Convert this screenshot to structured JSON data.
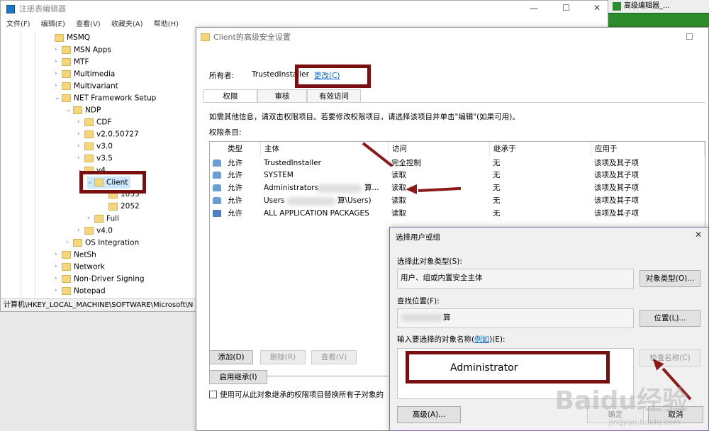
{
  "registry": {
    "title": "注册表编辑器",
    "menu": [
      "文件(F)",
      "编辑(E)",
      "查看(V)",
      "收藏夹(A)",
      "帮助(H)"
    ],
    "tree": [
      {
        "label": "MSMQ"
      },
      {
        "label": "MSN Apps"
      },
      {
        "label": "MTF"
      },
      {
        "label": "Multimedia"
      },
      {
        "label": "Multivariant"
      },
      {
        "label": "NET Framework Setup"
      },
      {
        "label": "NDP"
      },
      {
        "label": "CDF"
      },
      {
        "label": "v2.0.50727"
      },
      {
        "label": "v3.0"
      },
      {
        "label": "v3.5"
      },
      {
        "label": "v4"
      },
      {
        "label": "Client"
      },
      {
        "label": "1033"
      },
      {
        "label": "2052"
      },
      {
        "label": "Full"
      },
      {
        "label": "v4.0"
      },
      {
        "label": "OS Integration"
      },
      {
        "label": "NetSh"
      },
      {
        "label": "Network"
      },
      {
        "label": "Non-Driver Signing"
      },
      {
        "label": "Notepad"
      }
    ],
    "status_path": "计算机\\HKEY_LOCAL_MACHINE\\SOFTWARE\\Microsoft\\N"
  },
  "background_app": {
    "tab_label": "高级编辑器_..."
  },
  "security_dialog": {
    "title": "Client的高级安全设置",
    "owner_label": "所有者:",
    "owner_value": "TrustedInstaller",
    "owner_change_link": "更改(C)",
    "tabs": [
      "权限",
      "审核",
      "有效访问"
    ],
    "info_text": "如需其他信息，请双击权限项目。若要修改权限项目，请选择该项目并单击\"编辑\"(如果可用)。",
    "entries_label": "权限条目:",
    "columns": [
      "类型",
      "主体",
      "访问",
      "继承于",
      "应用于"
    ],
    "rows": [
      {
        "type": "允许",
        "principal": "TrustedInstaller",
        "access": "完全控制",
        "inherited": "无",
        "applies": "该项及其子项"
      },
      {
        "type": "允许",
        "principal": "SYSTEM",
        "access": "读取",
        "inherited": "无",
        "applies": "该项及其子项"
      },
      {
        "type": "允许",
        "principal": "Administrators",
        "principal_suffix": "算...",
        "access": "读取",
        "inherited": "无",
        "applies": "该项及其子项"
      },
      {
        "type": "允许",
        "principal": "Users",
        "principal_suffix": "算\\Users)",
        "access": "读取",
        "inherited": "无",
        "applies": "该项及其子项"
      },
      {
        "type": "允许",
        "principal": "ALL APPLICATION PACKAGES",
        "access": "读取",
        "inherited": "无",
        "applies": "该项及其子项"
      }
    ],
    "buttons": {
      "add": "添加(D)",
      "remove": "删除(R)",
      "view": "查看(V)",
      "enable_inheritance": "启用继承(I)"
    },
    "replace_checkbox_label": "使用可从此对象继承的权限项目替换所有子对象的"
  },
  "select_dialog": {
    "title": "选择用户或组",
    "object_type_label": "选择此对象类型(S):",
    "object_type_value": "用户、组或内置安全主体",
    "object_types_button": "对象类型(O)...",
    "location_label": "查找位置(F):",
    "location_value": "算",
    "locations_button": "位置(L)...",
    "names_label_prefix": "输入要选择的对象名称(",
    "names_label_link": "例如",
    "names_label_suffix": ")(E):",
    "names_value": "Administrator",
    "check_names_button": "检查名称(C)",
    "advanced_button": "高级(A)...",
    "ok_button": "确定",
    "cancel_button": "取消"
  },
  "watermark": {
    "brand": "Baidu经验",
    "url": "jingyan.baidu.com"
  },
  "colors": {
    "annotation": "#7a0f12",
    "link": "#0066cc",
    "folder": "#f5d77a"
  }
}
